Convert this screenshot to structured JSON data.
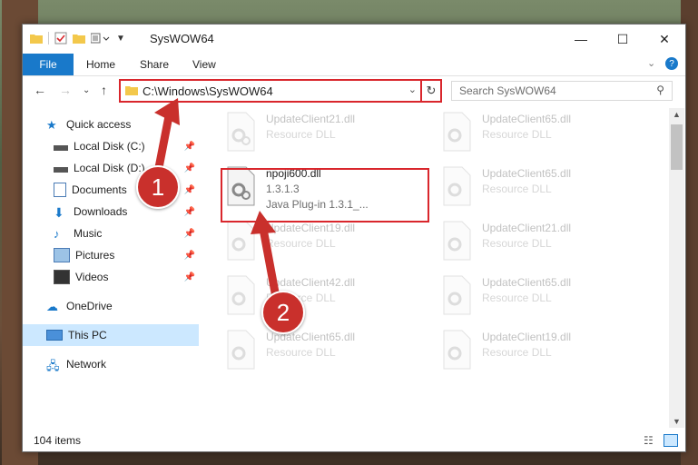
{
  "window": {
    "title": "SysWOW64",
    "minimize": "—",
    "maximize": "☐",
    "close": "✕"
  },
  "ribbon": {
    "file": "File",
    "tabs": [
      "Home",
      "Share",
      "View"
    ]
  },
  "nav": {
    "address": "C:\\Windows\\SysWOW64",
    "search_placeholder": "Search SysWOW64"
  },
  "sidebar": {
    "items": [
      {
        "label": "Quick access",
        "icon": "star-icon"
      },
      {
        "label": "Local Disk (C:)",
        "icon": "drive-icon"
      },
      {
        "label": "Local Disk (D:)",
        "icon": "drive-icon"
      },
      {
        "label": "Documents",
        "icon": "documents-icon"
      },
      {
        "label": "Downloads",
        "icon": "download-icon"
      },
      {
        "label": "Music",
        "icon": "music-icon"
      },
      {
        "label": "Pictures",
        "icon": "pictures-icon"
      },
      {
        "label": "Videos",
        "icon": "videos-icon"
      },
      {
        "label": "OneDrive",
        "icon": "cloud-icon"
      },
      {
        "label": "This PC",
        "icon": "computer-icon"
      },
      {
        "label": "Network",
        "icon": "network-icon"
      }
    ]
  },
  "files": [
    {
      "name": "UpdateClient21.dll",
      "sub": "Resource DLL",
      "sub2": ""
    },
    {
      "name": "UpdateClient65.dll",
      "sub": "Resource DLL",
      "sub2": ""
    },
    {
      "name": "npoji600.dll",
      "sub": "1.3.1.3",
      "sub2": "Java Plug-in 1.3.1_..."
    },
    {
      "name": "UpdateClient65.dll",
      "sub": "Resource DLL",
      "sub2": ""
    },
    {
      "name": "UpdateClient19.dll",
      "sub": "Resource DLL",
      "sub2": ""
    },
    {
      "name": "UpdateClient21.dll",
      "sub": "Resource DLL",
      "sub2": ""
    },
    {
      "name": "UpdateClient42.dll",
      "sub": "Resource DLL",
      "sub2": ""
    },
    {
      "name": "UpdateClient65.dll",
      "sub": "Resource DLL",
      "sub2": ""
    },
    {
      "name": "UpdateClient65.dll",
      "sub": "Resource DLL",
      "sub2": ""
    },
    {
      "name": "UpdateClient19.dll",
      "sub": "Resource DLL",
      "sub2": ""
    }
  ],
  "status": {
    "item_count": "104 items"
  },
  "annotations": {
    "step1": "1",
    "step2": "2",
    "color": "#c9302c"
  },
  "colors": {
    "accent": "#1979ca",
    "highlight": "#d9262c",
    "selected": "#cce8ff"
  }
}
